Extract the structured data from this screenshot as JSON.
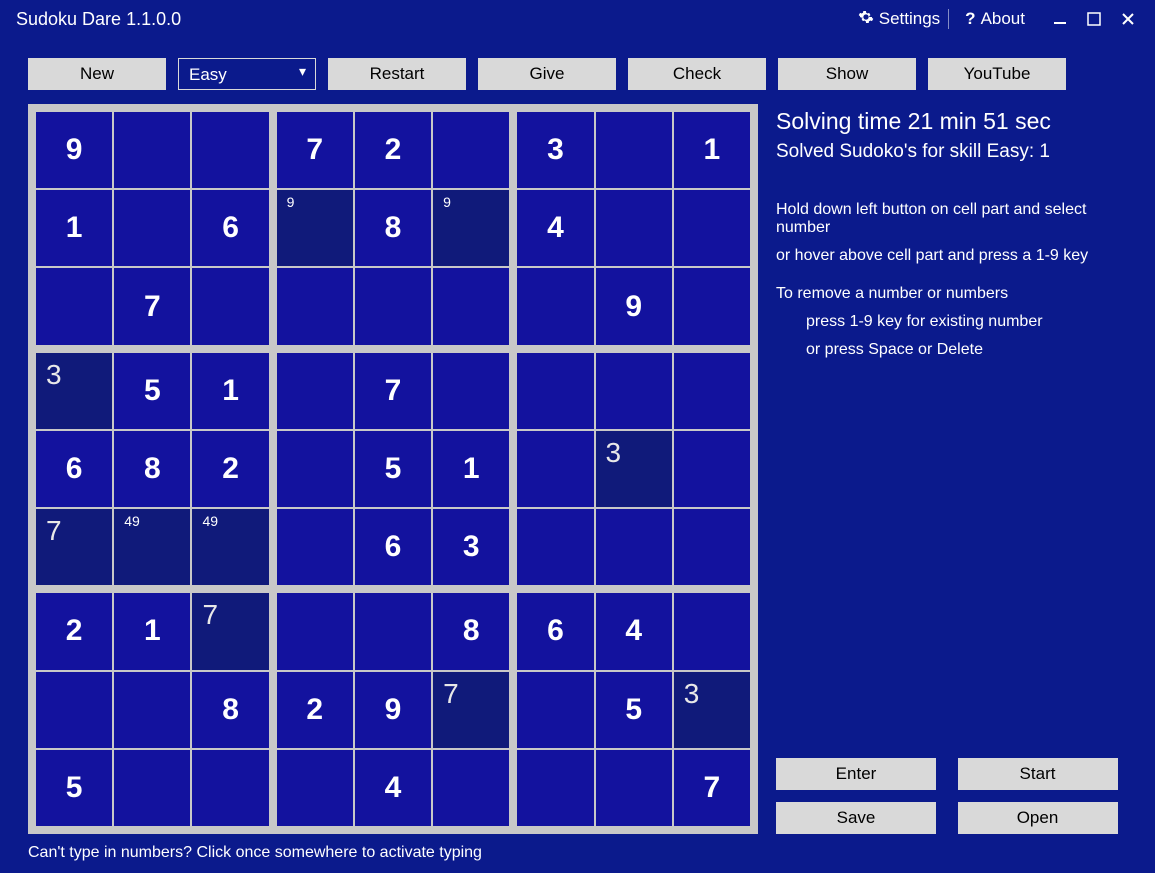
{
  "title": "Sudoku Dare 1.1.0.0",
  "titlebar": {
    "settings": "Settings",
    "about": "About"
  },
  "toolbar": {
    "new": "New",
    "difficulty_value": "Easy",
    "restart": "Restart",
    "give": "Give",
    "check": "Check",
    "show": "Show",
    "youtube": "YouTube"
  },
  "side": {
    "time": "Solving time 21 min 51 sec",
    "solved": "Solved Sudoko's for skill Easy: 1",
    "help1": "Hold down left button on cell part and select number",
    "help2": "or hover above cell part and press a 1-9 key",
    "help3": "To remove a number or numbers",
    "help4": "press 1-9 key for existing number",
    "help5": "or press Space or Delete",
    "enter": "Enter",
    "start": "Start",
    "save": "Save",
    "open": "Open"
  },
  "footer": "Can't type in numbers? Click once somewhere to activate typing",
  "grid": [
    [
      {
        "v": "9",
        "t": "f"
      },
      {
        "v": "",
        "t": ""
      },
      {
        "v": "",
        "t": ""
      },
      {
        "v": "7",
        "t": "f"
      },
      {
        "v": "2",
        "t": "f"
      },
      {
        "v": "",
        "t": ""
      },
      {
        "v": "3",
        "t": "f"
      },
      {
        "v": "",
        "t": ""
      },
      {
        "v": "1",
        "t": "f"
      }
    ],
    [
      {
        "v": "1",
        "t": "f"
      },
      {
        "v": "",
        "t": ""
      },
      {
        "v": "6",
        "t": "f"
      },
      {
        "v": "",
        "t": "h",
        "h": "9"
      },
      {
        "v": "8",
        "t": "f"
      },
      {
        "v": "",
        "t": "h",
        "h": "9"
      },
      {
        "v": "4",
        "t": "f"
      },
      {
        "v": "",
        "t": ""
      },
      {
        "v": "",
        "t": ""
      }
    ],
    [
      {
        "v": "",
        "t": ""
      },
      {
        "v": "7",
        "t": "f"
      },
      {
        "v": "",
        "t": ""
      },
      {
        "v": "",
        "t": ""
      },
      {
        "v": "",
        "t": ""
      },
      {
        "v": "",
        "t": ""
      },
      {
        "v": "",
        "t": ""
      },
      {
        "v": "9",
        "t": "f"
      },
      {
        "v": "",
        "t": ""
      }
    ],
    [
      {
        "v": "3",
        "t": "u"
      },
      {
        "v": "5",
        "t": "f"
      },
      {
        "v": "1",
        "t": "f"
      },
      {
        "v": "",
        "t": ""
      },
      {
        "v": "7",
        "t": "f"
      },
      {
        "v": "",
        "t": ""
      },
      {
        "v": "",
        "t": ""
      },
      {
        "v": "",
        "t": ""
      },
      {
        "v": "",
        "t": ""
      }
    ],
    [
      {
        "v": "6",
        "t": "f"
      },
      {
        "v": "8",
        "t": "f"
      },
      {
        "v": "2",
        "t": "f"
      },
      {
        "v": "",
        "t": ""
      },
      {
        "v": "5",
        "t": "f"
      },
      {
        "v": "1",
        "t": "f"
      },
      {
        "v": "",
        "t": ""
      },
      {
        "v": "3",
        "t": "u"
      },
      {
        "v": "",
        "t": ""
      }
    ],
    [
      {
        "v": "7",
        "t": "u"
      },
      {
        "v": "",
        "t": "h",
        "h": "49"
      },
      {
        "v": "",
        "t": "h",
        "h": "49"
      },
      {
        "v": "",
        "t": ""
      },
      {
        "v": "6",
        "t": "f"
      },
      {
        "v": "3",
        "t": "f"
      },
      {
        "v": "",
        "t": ""
      },
      {
        "v": "",
        "t": ""
      },
      {
        "v": "",
        "t": ""
      }
    ],
    [
      {
        "v": "2",
        "t": "f"
      },
      {
        "v": "1",
        "t": "f"
      },
      {
        "v": "7",
        "t": "u"
      },
      {
        "v": "",
        "t": ""
      },
      {
        "v": "",
        "t": ""
      },
      {
        "v": "8",
        "t": "f"
      },
      {
        "v": "6",
        "t": "f"
      },
      {
        "v": "4",
        "t": "f"
      },
      {
        "v": "",
        "t": ""
      }
    ],
    [
      {
        "v": "",
        "t": ""
      },
      {
        "v": "",
        "t": ""
      },
      {
        "v": "8",
        "t": "f"
      },
      {
        "v": "2",
        "t": "f"
      },
      {
        "v": "9",
        "t": "f"
      },
      {
        "v": "7",
        "t": "u"
      },
      {
        "v": "",
        "t": ""
      },
      {
        "v": "5",
        "t": "f"
      },
      {
        "v": "3",
        "t": "u"
      }
    ],
    [
      {
        "v": "5",
        "t": "f"
      },
      {
        "v": "",
        "t": ""
      },
      {
        "v": "",
        "t": ""
      },
      {
        "v": "",
        "t": ""
      },
      {
        "v": "4",
        "t": "f"
      },
      {
        "v": "",
        "t": ""
      },
      {
        "v": "",
        "t": ""
      },
      {
        "v": "",
        "t": ""
      },
      {
        "v": "7",
        "t": "f"
      }
    ]
  ]
}
